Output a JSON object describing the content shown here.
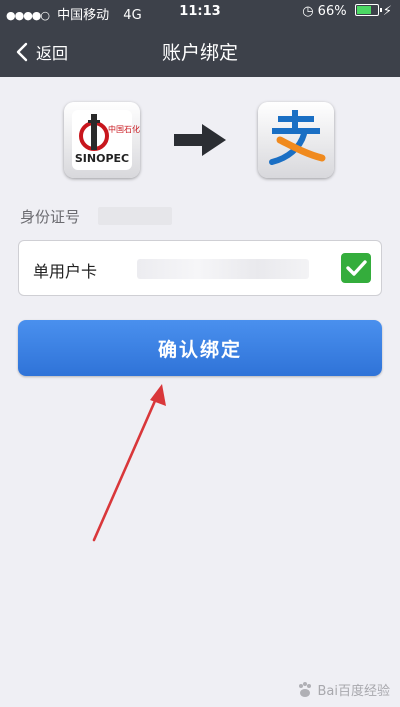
{
  "status_bar": {
    "signal_dots": "●●●●○",
    "carrier": "中国移动",
    "network": "4G",
    "time": "11:13",
    "battery_percent": "66%",
    "battery_level": 0.66
  },
  "nav": {
    "back_label": "返回",
    "title": "账户绑定"
  },
  "logos": {
    "source": "sinopec-logo",
    "target": "alipay-logo",
    "source_text": "SINOPEC",
    "source_chinese": "中国石化"
  },
  "form": {
    "id_label": "身份证号",
    "card_label": "单用户卡",
    "card_checked": true
  },
  "confirm_button": {
    "label": "确认绑定"
  },
  "watermark": {
    "text": "Bai百度经验"
  },
  "colors": {
    "nav_bg": "#3d414a",
    "page_bg": "#efeff4",
    "button_blue": "#3a80e2",
    "check_green": "#34ad3c",
    "annotation_red": "#d9373a",
    "alipay_blue": "#1a6fc4",
    "alipay_orange": "#f08a1e",
    "sinopec_red": "#c8161d"
  }
}
